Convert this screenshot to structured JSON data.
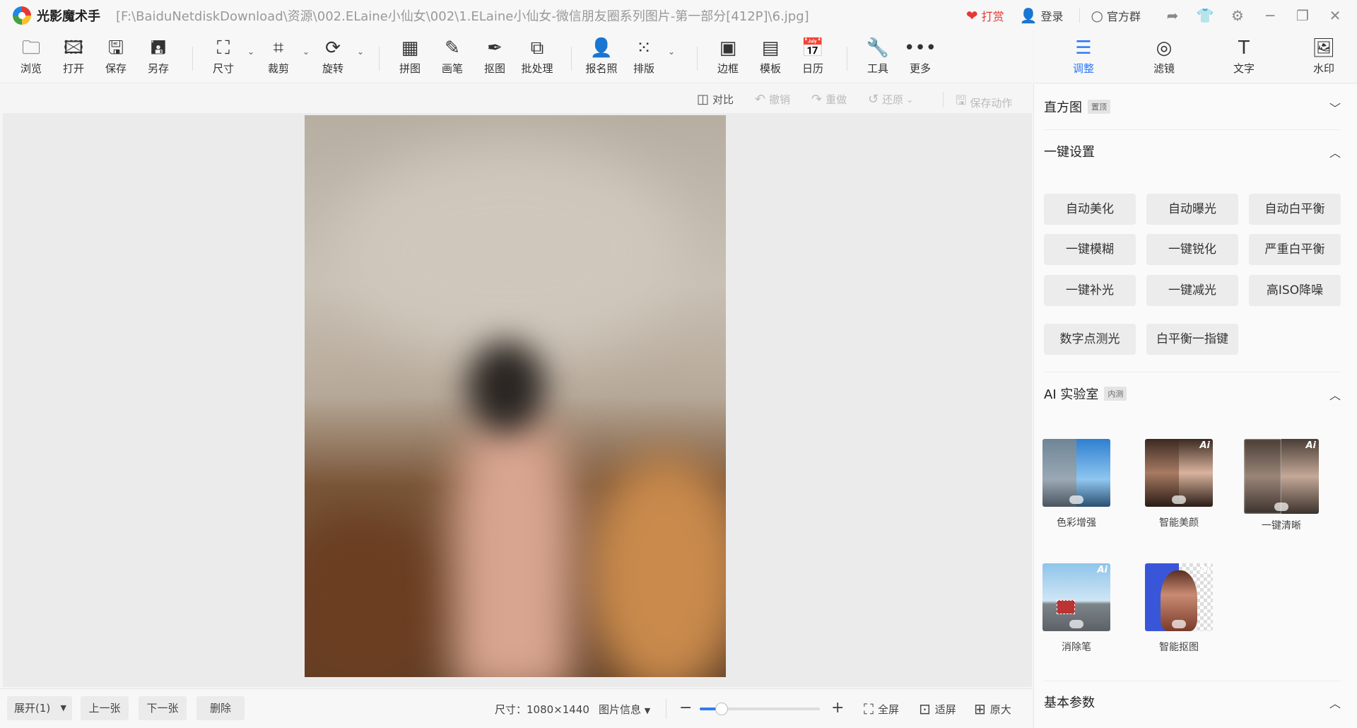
{
  "window": {
    "app_name": "光影魔术手",
    "file_path": "[F:\\BaiduNetdiskDownload\\资源\\002.ELaine小仙女\\002\\1.ELaine小仙女-微信朋友圈系列图片-第一部分[412P]\\6.jpg]",
    "reward_label": "打赏",
    "login_label": "登录",
    "group_label": "官方群"
  },
  "toolbar": {
    "browse": "浏览",
    "open": "打开",
    "save": "保存",
    "save_as": "另存",
    "size": "尺寸",
    "crop": "裁剪",
    "rotate": "旋转",
    "collage": "拼图",
    "brush": "画笔",
    "cutout": "抠图",
    "batch": "批处理",
    "id_photo": "报名照",
    "layout": "排版",
    "border": "边框",
    "template": "模板",
    "calendar": "日历",
    "tools": "工具",
    "more": "更多"
  },
  "panel_tabs": {
    "adjust": "调整",
    "filter": "滤镜",
    "text": "文字",
    "watermark": "水印"
  },
  "editbar": {
    "compare": "对比",
    "undo": "撤销",
    "redo": "重做",
    "restore": "还原",
    "save_action": "保存动作"
  },
  "panel": {
    "histogram": {
      "title": "直方图",
      "tag": "置顶"
    },
    "quick": {
      "title": "一键设置",
      "buttons": [
        "自动美化",
        "自动曝光",
        "自动白平衡",
        "一键模糊",
        "一键锐化",
        "严重白平衡",
        "一键补光",
        "一键减光",
        "高ISO降噪",
        "数字点测光",
        "白平衡一指键"
      ]
    },
    "ai": {
      "title": "AI 实验室",
      "tag": "内测",
      "items": [
        "色彩增强",
        "智能美颜",
        "一键清晰",
        "消除笔",
        "智能抠图"
      ]
    },
    "basic": {
      "title": "基本参数"
    }
  },
  "statusbar": {
    "expand": "展开(1)",
    "prev": "上一张",
    "next": "下一张",
    "delete": "删除",
    "size_text": "尺寸：1080×1440",
    "info": "图片信息",
    "fullscreen": "全屏",
    "fit": "适屏",
    "original": "原大",
    "zoom_fraction": 0.18
  },
  "colors": {
    "accent": "#2f7bf5",
    "reward": "#e53935"
  }
}
